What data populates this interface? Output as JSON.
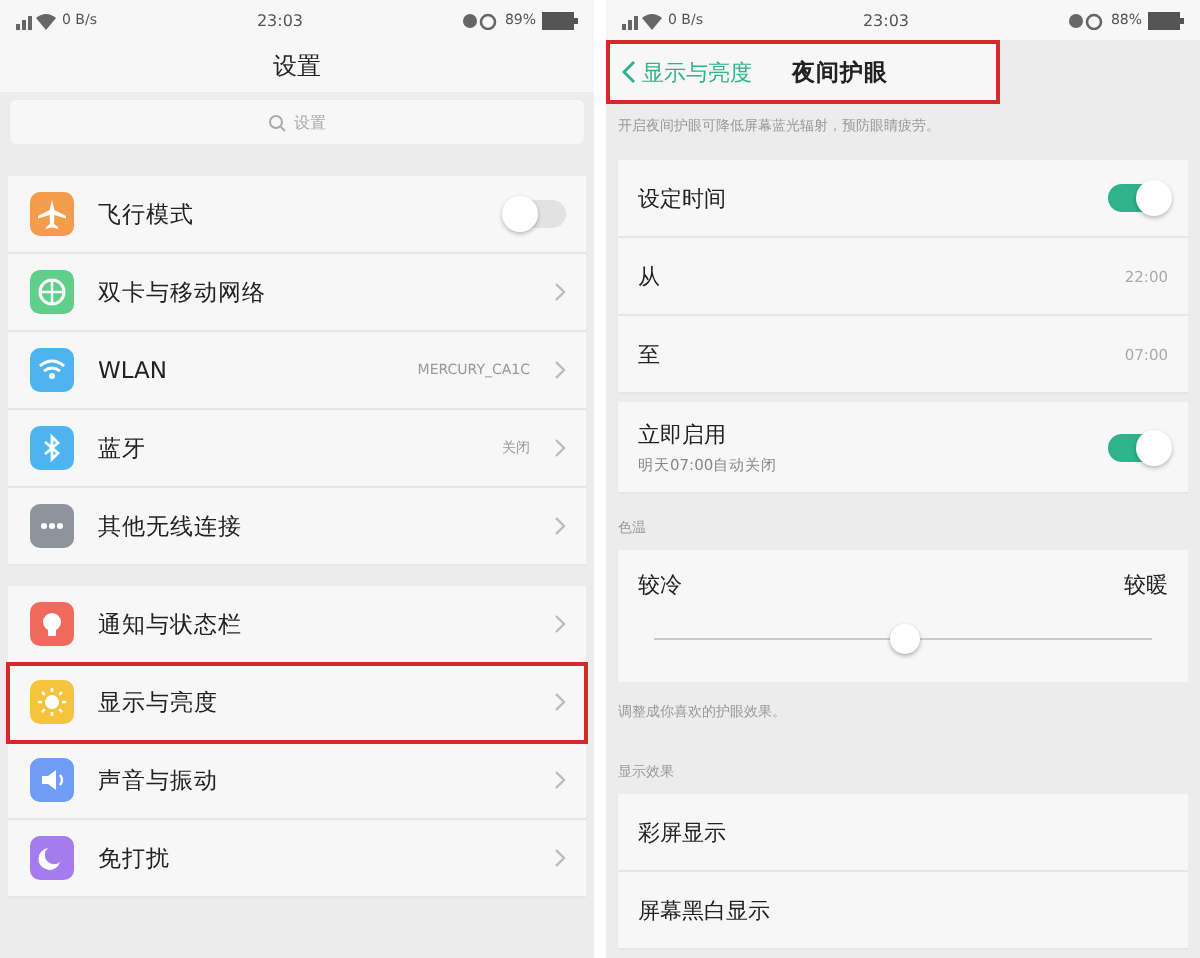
{
  "left_screen": {
    "status_bar": {
      "speed": "0 B/s",
      "time": "23:03",
      "battery": "89%"
    },
    "title": "设置",
    "search": {
      "placeholder": "设置"
    },
    "groups": [
      {
        "items": [
          {
            "label": "飞行模式",
            "kind": "toggle",
            "on": false,
            "highlighted": false
          },
          {
            "label": "双卡与移动网络",
            "kind": "link",
            "highlighted": false
          },
          {
            "label": "WLAN",
            "kind": "link",
            "value": "MERCURY_CA1C",
            "highlighted": false
          },
          {
            "label": "蓝牙",
            "kind": "link",
            "value": "关闭",
            "highlighted": false
          },
          {
            "label": "其他无线连接",
            "kind": "link",
            "highlighted": false
          }
        ]
      },
      {
        "items": [
          {
            "label": "通知与状态栏",
            "kind": "link",
            "highlighted": false
          },
          {
            "label": "显示与亮度",
            "kind": "link",
            "highlighted": true
          },
          {
            "label": "声音与振动",
            "kind": "link",
            "highlighted": false
          },
          {
            "label": "免打扰",
            "kind": "link",
            "highlighted": false
          }
        ]
      }
    ]
  },
  "right_screen": {
    "status_bar": {
      "speed": "0 B/s",
      "time": "23:03",
      "battery": "88%"
    },
    "header": {
      "back": "显示与亮度",
      "title": "夜间护眼",
      "highlighted": true
    },
    "blocks": [
      {
        "kind": "note",
        "text": "开启夜间护眼可降低屏幕蓝光辐射，预防眼睛疲劳。"
      },
      {
        "kind": "card",
        "rows": [
          {
            "label": "设定时间",
            "kind": "toggle",
            "on": true
          },
          {
            "label": "从",
            "kind": "value",
            "value": "22:00"
          },
          {
            "label": "至",
            "kind": "value",
            "value": "07:00"
          }
        ]
      },
      {
        "kind": "card",
        "rows": [
          {
            "label": "立即启用",
            "sub": "明天07:00自动关闭",
            "kind": "toggle",
            "on": true
          }
        ]
      },
      {
        "kind": "section",
        "text": "色温"
      },
      {
        "kind": "slider",
        "cool": "较冷",
        "warm": "较暖",
        "level": 0.5
      },
      {
        "kind": "note",
        "text": "调整成你喜欢的护眼效果。"
      },
      {
        "kind": "section",
        "text": "显示效果"
      },
      {
        "kind": "card",
        "rows": [
          {
            "label": "彩屏显示",
            "kind": "plain"
          },
          {
            "label": "屏幕黑白显示",
            "kind": "plain"
          }
        ]
      }
    ]
  }
}
